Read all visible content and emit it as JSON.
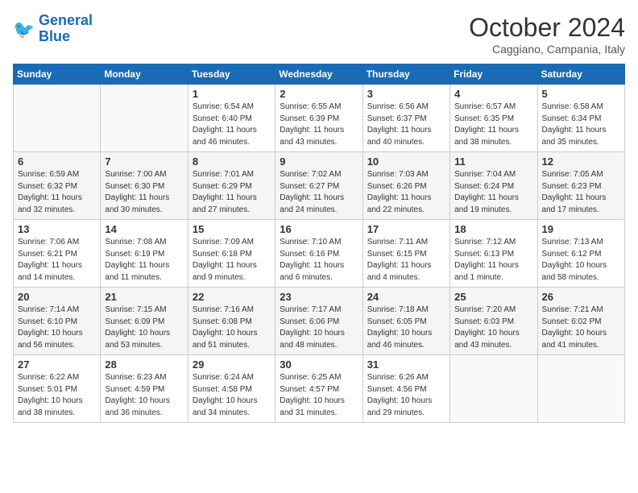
{
  "logo": {
    "text_general": "General",
    "text_blue": "Blue"
  },
  "title": "October 2024",
  "subtitle": "Caggiano, Campania, Italy",
  "weekdays": [
    "Sunday",
    "Monday",
    "Tuesday",
    "Wednesday",
    "Thursday",
    "Friday",
    "Saturday"
  ],
  "weeks": [
    [
      {
        "day": "",
        "sunrise": "",
        "sunset": "",
        "daylight": ""
      },
      {
        "day": "",
        "sunrise": "",
        "sunset": "",
        "daylight": ""
      },
      {
        "day": "1",
        "sunrise": "Sunrise: 6:54 AM",
        "sunset": "Sunset: 6:40 PM",
        "daylight": "Daylight: 11 hours and 46 minutes."
      },
      {
        "day": "2",
        "sunrise": "Sunrise: 6:55 AM",
        "sunset": "Sunset: 6:39 PM",
        "daylight": "Daylight: 11 hours and 43 minutes."
      },
      {
        "day": "3",
        "sunrise": "Sunrise: 6:56 AM",
        "sunset": "Sunset: 6:37 PM",
        "daylight": "Daylight: 11 hours and 40 minutes."
      },
      {
        "day": "4",
        "sunrise": "Sunrise: 6:57 AM",
        "sunset": "Sunset: 6:35 PM",
        "daylight": "Daylight: 11 hours and 38 minutes."
      },
      {
        "day": "5",
        "sunrise": "Sunrise: 6:58 AM",
        "sunset": "Sunset: 6:34 PM",
        "daylight": "Daylight: 11 hours and 35 minutes."
      }
    ],
    [
      {
        "day": "6",
        "sunrise": "Sunrise: 6:59 AM",
        "sunset": "Sunset: 6:32 PM",
        "daylight": "Daylight: 11 hours and 32 minutes."
      },
      {
        "day": "7",
        "sunrise": "Sunrise: 7:00 AM",
        "sunset": "Sunset: 6:30 PM",
        "daylight": "Daylight: 11 hours and 30 minutes."
      },
      {
        "day": "8",
        "sunrise": "Sunrise: 7:01 AM",
        "sunset": "Sunset: 6:29 PM",
        "daylight": "Daylight: 11 hours and 27 minutes."
      },
      {
        "day": "9",
        "sunrise": "Sunrise: 7:02 AM",
        "sunset": "Sunset: 6:27 PM",
        "daylight": "Daylight: 11 hours and 24 minutes."
      },
      {
        "day": "10",
        "sunrise": "Sunrise: 7:03 AM",
        "sunset": "Sunset: 6:26 PM",
        "daylight": "Daylight: 11 hours and 22 minutes."
      },
      {
        "day": "11",
        "sunrise": "Sunrise: 7:04 AM",
        "sunset": "Sunset: 6:24 PM",
        "daylight": "Daylight: 11 hours and 19 minutes."
      },
      {
        "day": "12",
        "sunrise": "Sunrise: 7:05 AM",
        "sunset": "Sunset: 6:23 PM",
        "daylight": "Daylight: 11 hours and 17 minutes."
      }
    ],
    [
      {
        "day": "13",
        "sunrise": "Sunrise: 7:06 AM",
        "sunset": "Sunset: 6:21 PM",
        "daylight": "Daylight: 11 hours and 14 minutes."
      },
      {
        "day": "14",
        "sunrise": "Sunrise: 7:08 AM",
        "sunset": "Sunset: 6:19 PM",
        "daylight": "Daylight: 11 hours and 11 minutes."
      },
      {
        "day": "15",
        "sunrise": "Sunrise: 7:09 AM",
        "sunset": "Sunset: 6:18 PM",
        "daylight": "Daylight: 11 hours and 9 minutes."
      },
      {
        "day": "16",
        "sunrise": "Sunrise: 7:10 AM",
        "sunset": "Sunset: 6:16 PM",
        "daylight": "Daylight: 11 hours and 6 minutes."
      },
      {
        "day": "17",
        "sunrise": "Sunrise: 7:11 AM",
        "sunset": "Sunset: 6:15 PM",
        "daylight": "Daylight: 11 hours and 4 minutes."
      },
      {
        "day": "18",
        "sunrise": "Sunrise: 7:12 AM",
        "sunset": "Sunset: 6:13 PM",
        "daylight": "Daylight: 11 hours and 1 minute."
      },
      {
        "day": "19",
        "sunrise": "Sunrise: 7:13 AM",
        "sunset": "Sunset: 6:12 PM",
        "daylight": "Daylight: 10 hours and 58 minutes."
      }
    ],
    [
      {
        "day": "20",
        "sunrise": "Sunrise: 7:14 AM",
        "sunset": "Sunset: 6:10 PM",
        "daylight": "Daylight: 10 hours and 56 minutes."
      },
      {
        "day": "21",
        "sunrise": "Sunrise: 7:15 AM",
        "sunset": "Sunset: 6:09 PM",
        "daylight": "Daylight: 10 hours and 53 minutes."
      },
      {
        "day": "22",
        "sunrise": "Sunrise: 7:16 AM",
        "sunset": "Sunset: 6:08 PM",
        "daylight": "Daylight: 10 hours and 51 minutes."
      },
      {
        "day": "23",
        "sunrise": "Sunrise: 7:17 AM",
        "sunset": "Sunset: 6:06 PM",
        "daylight": "Daylight: 10 hours and 48 minutes."
      },
      {
        "day": "24",
        "sunrise": "Sunrise: 7:18 AM",
        "sunset": "Sunset: 6:05 PM",
        "daylight": "Daylight: 10 hours and 46 minutes."
      },
      {
        "day": "25",
        "sunrise": "Sunrise: 7:20 AM",
        "sunset": "Sunset: 6:03 PM",
        "daylight": "Daylight: 10 hours and 43 minutes."
      },
      {
        "day": "26",
        "sunrise": "Sunrise: 7:21 AM",
        "sunset": "Sunset: 6:02 PM",
        "daylight": "Daylight: 10 hours and 41 minutes."
      }
    ],
    [
      {
        "day": "27",
        "sunrise": "Sunrise: 6:22 AM",
        "sunset": "Sunset: 5:01 PM",
        "daylight": "Daylight: 10 hours and 38 minutes."
      },
      {
        "day": "28",
        "sunrise": "Sunrise: 6:23 AM",
        "sunset": "Sunset: 4:59 PM",
        "daylight": "Daylight: 10 hours and 36 minutes."
      },
      {
        "day": "29",
        "sunrise": "Sunrise: 6:24 AM",
        "sunset": "Sunset: 4:58 PM",
        "daylight": "Daylight: 10 hours and 34 minutes."
      },
      {
        "day": "30",
        "sunrise": "Sunrise: 6:25 AM",
        "sunset": "Sunset: 4:57 PM",
        "daylight": "Daylight: 10 hours and 31 minutes."
      },
      {
        "day": "31",
        "sunrise": "Sunrise: 6:26 AM",
        "sunset": "Sunset: 4:56 PM",
        "daylight": "Daylight: 10 hours and 29 minutes."
      },
      {
        "day": "",
        "sunrise": "",
        "sunset": "",
        "daylight": ""
      },
      {
        "day": "",
        "sunrise": "",
        "sunset": "",
        "daylight": ""
      }
    ]
  ]
}
